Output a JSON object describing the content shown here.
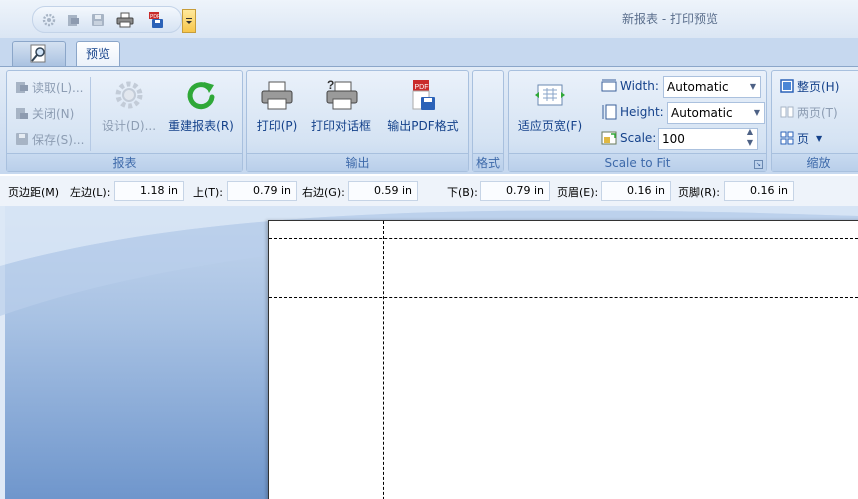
{
  "window": {
    "title": "新报表 - 打印预览"
  },
  "tabs": {
    "preview_label": "预览"
  },
  "ribbon": {
    "report": {
      "label": "报表",
      "load": "读取(L)...",
      "close": "关闭(N)",
      "save": "保存(S)...",
      "design": "设计(D)...",
      "rebuild": "重建报表(R)"
    },
    "output": {
      "label": "输出",
      "print": "打印(P)",
      "print_dialog": "打印对话框",
      "export_pdf": "输出PDF格式"
    },
    "format": {
      "label": "格式"
    },
    "scale_to_fit": {
      "label": "Scale to Fit",
      "fit_width": "适应页宽(F)",
      "width_label": "Width:",
      "width_value": "Automatic",
      "height_label": "Height:",
      "height_value": "Automatic",
      "scale_label": "Scale:",
      "scale_value": "100"
    },
    "zoom": {
      "label": "缩放",
      "whole_page": "整页(H)",
      "two_pages": "两页(T)",
      "pages": "页"
    }
  },
  "margins": {
    "title": "页边距(M)",
    "left_label": "左边(L):",
    "left_value": "1.18 in",
    "top_label": "上(T):",
    "top_value": "0.79 in",
    "right_label": "右边(G):",
    "right_value": "0.59 in",
    "bottom_label": "下(B):",
    "bottom_value": "0.79 in",
    "header_label": "页眉(E):",
    "header_value": "0.16 in",
    "footer_label": "页脚(R):",
    "footer_value": "0.16 in"
  },
  "colors": {
    "ribbon_text": "#15428b",
    "group_label": "#3e6aaa",
    "preview_bg_top": "#c5d7ee",
    "preview_bg_bottom": "#6f96cc"
  }
}
